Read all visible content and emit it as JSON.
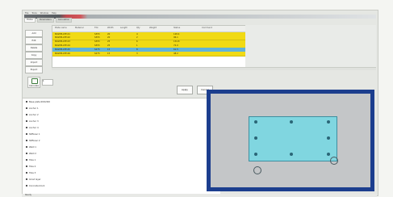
{
  "menu": [
    "File",
    "Tools",
    "Window",
    "Help"
  ],
  "tabs": [
    "Plates",
    "Parameters",
    "Calculation"
  ],
  "left_buttons": [
    "Add",
    "Edit",
    "Delete",
    "Copy",
    "Import",
    "Export"
  ],
  "grid": {
    "columns": [
      "Plate name",
      "Material",
      "Thk",
      "Width",
      "Length",
      "Qty",
      "Weight",
      "Status",
      "Comment"
    ],
    "rows": [
      {
        "name": "BASEPLATE-01",
        "mat": "S355",
        "thk": "20",
        "qty": "4",
        "wt": "128.4",
        "style": "yellow"
      },
      {
        "name": "BASEPLATE-02",
        "mat": "S355",
        "thk": "20",
        "qty": "2",
        "wt": "96.1",
        "style": "yellow"
      },
      {
        "name": "BASEPLATE-03",
        "mat": "S355",
        "thk": "25",
        "qty": "6",
        "wt": "154.8",
        "style": "yellow"
      },
      {
        "name": "BASEPLATE-04",
        "mat": "S355",
        "thk": "25",
        "qty": "1",
        "wt": "72.0",
        "style": "yellow"
      },
      {
        "name": "BASEPLATE-05",
        "mat": "S275",
        "thk": "15",
        "qty": "8",
        "wt": "61.5",
        "style": "sel"
      },
      {
        "name": "BASEPLATE-06",
        "mat": "S275",
        "thk": "15",
        "qty": "3",
        "wt": "48.2",
        "style": "yellow"
      }
    ]
  },
  "mid": {
    "icon_label": "Calculate",
    "field_value": "1"
  },
  "actions": {
    "apply": "Apply",
    "cancel": "Cancel"
  },
  "list_items": [
    "Base plate 600x300",
    "Anchor 1",
    "Anchor 2",
    "Anchor 3",
    "Anchor 4",
    "Stiffener 1",
    "Stiffener 2",
    "Weld 1",
    "Weld 2",
    "Hole 1",
    "Hole 2",
    "Hole 3",
    "Grout layer",
    "Concrete block"
  ],
  "status": {
    "text": "Ready"
  },
  "colors": {
    "yellow": "#f1da14",
    "selected": "#62b3d8",
    "viewer_frame": "#1c3e8e",
    "plate": "#80d6e0"
  }
}
